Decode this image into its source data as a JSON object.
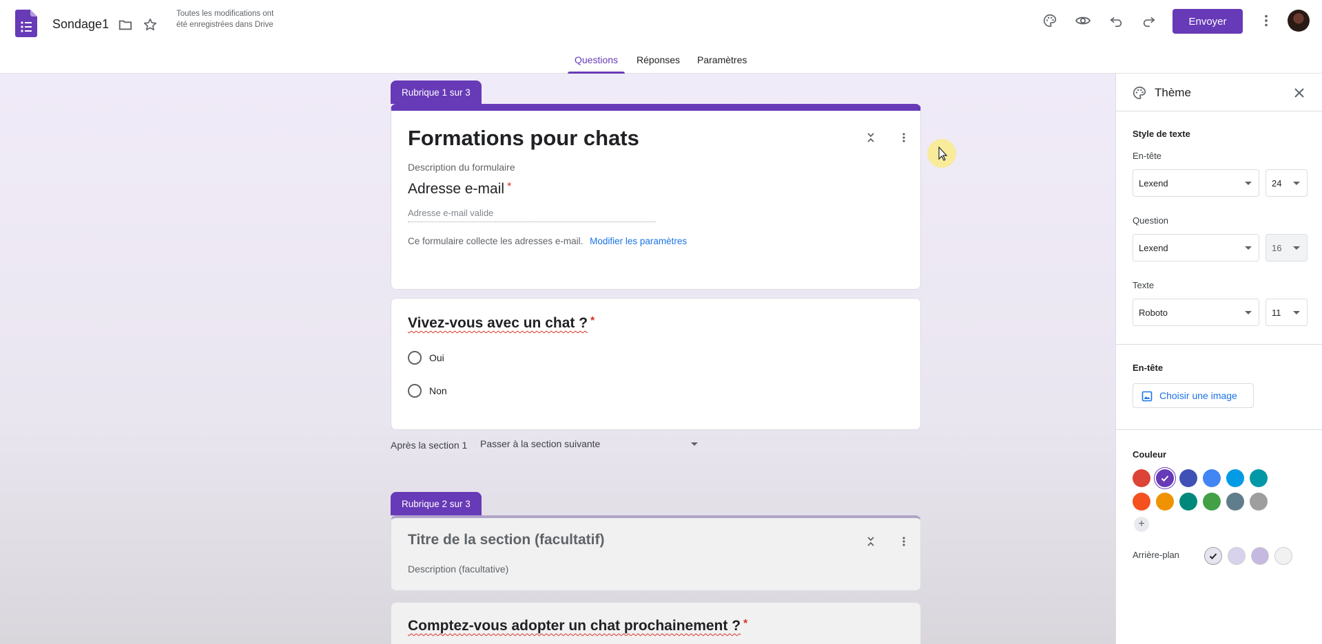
{
  "header": {
    "doc_title": "Sondage1",
    "save_status": "Toutes les modifications ont été enregistrées dans Drive",
    "send_label": "Envoyer",
    "icons": [
      "palette-icon",
      "eye-icon",
      "undo-icon",
      "redo-icon",
      "more-vert-icon"
    ]
  },
  "tabs": [
    {
      "label": "Questions",
      "active": true
    },
    {
      "label": "Réponses",
      "active": false
    },
    {
      "label": "Paramètres",
      "active": false
    }
  ],
  "section1": {
    "pill": "Rubrique 1 sur 3",
    "title": "Formations pour chats",
    "description": "Description du formulaire",
    "email_title": "Adresse e-mail",
    "email_required": "*",
    "email_placeholder": "Adresse e-mail valide",
    "collect_note": "Ce formulaire collecte les adresses e-mail.",
    "collect_link": "Modifier les paramètres"
  },
  "question1": {
    "title": "Vivez-vous avec un chat ?",
    "required": "*",
    "options": [
      "Oui",
      "Non"
    ]
  },
  "after_section": {
    "label": "Après la section 1",
    "value": "Passer à la section suivante"
  },
  "section2": {
    "pill": "Rubrique 2 sur 3",
    "title": "Titre de la section (facultatif)",
    "description": "Description (facultative)"
  },
  "question2": {
    "title": "Comptez-vous adopter un chat prochainement ?",
    "required": "*"
  },
  "theme_panel": {
    "title": "Thème",
    "text_style_label": "Style de texte",
    "header_label": "En-tête",
    "header_font": "Lexend",
    "header_size": "24",
    "question_label": "Question",
    "question_font": "Lexend",
    "question_size": "16",
    "text_label": "Texte",
    "text_font": "Roboto",
    "text_size": "11",
    "header_image_label": "En-tête",
    "choose_image_label": "Choisir une image",
    "color_label": "Couleur",
    "colors_row1": [
      "#db4437",
      "#673ab7",
      "#3f51b5",
      "#4285f4",
      "#039be5",
      "#0097a7"
    ],
    "colors_row2": [
      "#f4511e",
      "#f09300",
      "#00897b",
      "#43a047",
      "#607d8b",
      "#9e9e9e"
    ],
    "selected_color": "#673ab7",
    "add_color": "+",
    "background_label": "Arrière-plan",
    "background_colors": [
      "#e8e4ee",
      "#d9d2ec",
      "#c5b9e2",
      "#f1f1f1"
    ],
    "selected_background": "#e8e4ee"
  }
}
